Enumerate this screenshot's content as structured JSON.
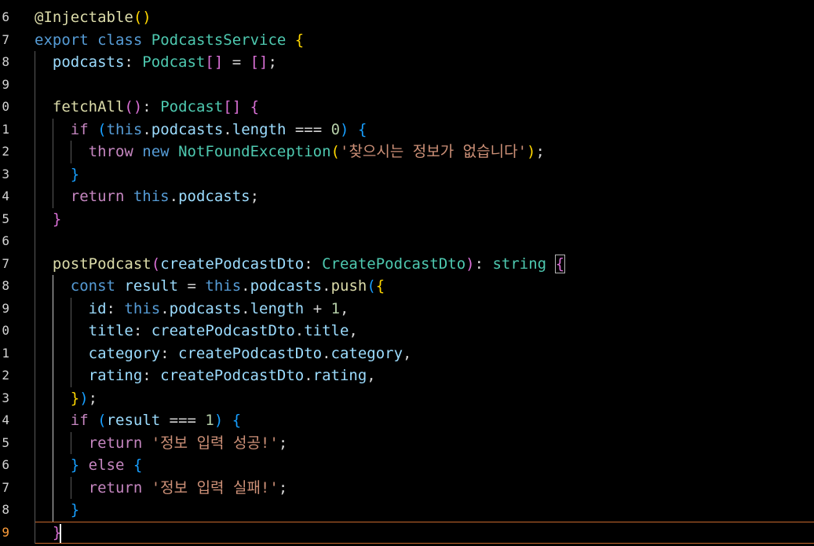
{
  "editor": {
    "gutter_digits": [
      "6",
      "7",
      "8",
      "9",
      "0",
      "1",
      "2",
      "3",
      "4",
      "5",
      "6",
      "7",
      "8",
      "9",
      "0",
      "1",
      "2",
      "3",
      "4",
      "5",
      "6",
      "7",
      "8",
      "9"
    ],
    "active_gutter_index": 23,
    "lines": [
      [
        [
          "@Injectable",
          "fn"
        ],
        [
          "()",
          "br1"
        ]
      ],
      [
        [
          "export",
          "kw-blue"
        ],
        [
          " ",
          "punct"
        ],
        [
          "class",
          "kw-blue"
        ],
        [
          " ",
          "punct"
        ],
        [
          "PodcastsService",
          "type"
        ],
        [
          " ",
          "punct"
        ],
        [
          "{",
          "br1"
        ]
      ],
      [
        [
          "  ",
          "punct"
        ],
        [
          "podcasts",
          "var"
        ],
        [
          ": ",
          "punct"
        ],
        [
          "Podcast",
          "type"
        ],
        [
          "[]",
          "br2"
        ],
        [
          " = ",
          "punct"
        ],
        [
          "[]",
          "br2"
        ],
        [
          ";",
          "punct"
        ]
      ],
      [
        [
          "",
          "punct"
        ]
      ],
      [
        [
          "  ",
          "punct"
        ],
        [
          "fetchAll",
          "fn"
        ],
        [
          "()",
          "br2"
        ],
        [
          ": ",
          "punct"
        ],
        [
          "Podcast",
          "type"
        ],
        [
          "[]",
          "br2"
        ],
        [
          " ",
          "punct"
        ],
        [
          "{",
          "br2"
        ]
      ],
      [
        [
          "    ",
          "punct"
        ],
        [
          "if",
          "kw-pink"
        ],
        [
          " ",
          "punct"
        ],
        [
          "(",
          "br3"
        ],
        [
          "this",
          "kw-blue"
        ],
        [
          ".",
          "punct"
        ],
        [
          "podcasts",
          "var"
        ],
        [
          ".",
          "punct"
        ],
        [
          "length",
          "var"
        ],
        [
          " === ",
          "punct"
        ],
        [
          "0",
          "num"
        ],
        [
          ")",
          "br3"
        ],
        [
          " ",
          "punct"
        ],
        [
          "{",
          "br3"
        ]
      ],
      [
        [
          "      ",
          "punct"
        ],
        [
          "throw",
          "kw-pink"
        ],
        [
          " ",
          "punct"
        ],
        [
          "new",
          "kw-blue"
        ],
        [
          " ",
          "punct"
        ],
        [
          "NotFoundException",
          "type"
        ],
        [
          "(",
          "br1"
        ],
        [
          "'찾으시는 정보가 없습니다'",
          "str"
        ],
        [
          ")",
          "br1"
        ],
        [
          ";",
          "punct"
        ]
      ],
      [
        [
          "    ",
          "punct"
        ],
        [
          "}",
          "br3"
        ]
      ],
      [
        [
          "    ",
          "punct"
        ],
        [
          "return",
          "kw-pink"
        ],
        [
          " ",
          "punct"
        ],
        [
          "this",
          "kw-blue"
        ],
        [
          ".",
          "punct"
        ],
        [
          "podcasts",
          "var"
        ],
        [
          ";",
          "punct"
        ]
      ],
      [
        [
          "  ",
          "punct"
        ],
        [
          "}",
          "br2"
        ]
      ],
      [
        [
          "",
          "punct"
        ]
      ],
      [
        [
          "  ",
          "punct"
        ],
        [
          "postPodcast",
          "fn"
        ],
        [
          "(",
          "br2"
        ],
        [
          "createPodcastDto",
          "var"
        ],
        [
          ": ",
          "punct"
        ],
        [
          "CreatePodcastDto",
          "type"
        ],
        [
          ")",
          "br2"
        ],
        [
          ": ",
          "punct"
        ],
        [
          "string",
          "type"
        ],
        [
          " ",
          "punct"
        ],
        [
          "{",
          "br2"
        ]
      ],
      [
        [
          "    ",
          "punct"
        ],
        [
          "const",
          "kw-blue"
        ],
        [
          " ",
          "punct"
        ],
        [
          "result",
          "var"
        ],
        [
          " = ",
          "punct"
        ],
        [
          "this",
          "kw-blue"
        ],
        [
          ".",
          "punct"
        ],
        [
          "podcasts",
          "var"
        ],
        [
          ".",
          "punct"
        ],
        [
          "push",
          "fn"
        ],
        [
          "(",
          "br3"
        ],
        [
          "{",
          "br1"
        ]
      ],
      [
        [
          "      ",
          "punct"
        ],
        [
          "id",
          "var"
        ],
        [
          ": ",
          "punct"
        ],
        [
          "this",
          "kw-blue"
        ],
        [
          ".",
          "punct"
        ],
        [
          "podcasts",
          "var"
        ],
        [
          ".",
          "punct"
        ],
        [
          "length",
          "var"
        ],
        [
          " + ",
          "punct"
        ],
        [
          "1",
          "num"
        ],
        [
          ",",
          "punct"
        ]
      ],
      [
        [
          "      ",
          "punct"
        ],
        [
          "title",
          "var"
        ],
        [
          ": ",
          "punct"
        ],
        [
          "createPodcastDto",
          "var"
        ],
        [
          ".",
          "punct"
        ],
        [
          "title",
          "var"
        ],
        [
          ",",
          "punct"
        ]
      ],
      [
        [
          "      ",
          "punct"
        ],
        [
          "category",
          "var"
        ],
        [
          ": ",
          "punct"
        ],
        [
          "createPodcastDto",
          "var"
        ],
        [
          ".",
          "punct"
        ],
        [
          "category",
          "var"
        ],
        [
          ",",
          "punct"
        ]
      ],
      [
        [
          "      ",
          "punct"
        ],
        [
          "rating",
          "var"
        ],
        [
          ": ",
          "punct"
        ],
        [
          "createPodcastDto",
          "var"
        ],
        [
          ".",
          "punct"
        ],
        [
          "rating",
          "var"
        ],
        [
          ",",
          "punct"
        ]
      ],
      [
        [
          "    ",
          "punct"
        ],
        [
          "}",
          "br1"
        ],
        [
          ")",
          "br3"
        ],
        [
          ";",
          "punct"
        ]
      ],
      [
        [
          "    ",
          "punct"
        ],
        [
          "if",
          "kw-pink"
        ],
        [
          " ",
          "punct"
        ],
        [
          "(",
          "br3"
        ],
        [
          "result",
          "var"
        ],
        [
          " === ",
          "punct"
        ],
        [
          "1",
          "num"
        ],
        [
          ")",
          "br3"
        ],
        [
          " ",
          "punct"
        ],
        [
          "{",
          "br3"
        ]
      ],
      [
        [
          "      ",
          "punct"
        ],
        [
          "return",
          "kw-pink"
        ],
        [
          " ",
          "punct"
        ],
        [
          "'정보 입력 성공!'",
          "str"
        ],
        [
          ";",
          "punct"
        ]
      ],
      [
        [
          "    ",
          "punct"
        ],
        [
          "}",
          "br3"
        ],
        [
          " ",
          "punct"
        ],
        [
          "else",
          "kw-pink"
        ],
        [
          " ",
          "punct"
        ],
        [
          "{",
          "br3"
        ]
      ],
      [
        [
          "      ",
          "punct"
        ],
        [
          "return",
          "kw-pink"
        ],
        [
          " ",
          "punct"
        ],
        [
          "'정보 입력 실패!'",
          "str"
        ],
        [
          ";",
          "punct"
        ]
      ],
      [
        [
          "    ",
          "punct"
        ],
        [
          "}",
          "br3"
        ]
      ],
      [
        [
          "  ",
          "punct"
        ],
        [
          "}",
          "br2"
        ]
      ]
    ]
  },
  "colors": {
    "background": "#000000",
    "keyword_blue": "#569cd6",
    "keyword_pink": "#c586c0",
    "function": "#dcdcaa",
    "variable": "#9cdcfe",
    "type": "#4ec9b0",
    "string": "#ce9178",
    "number": "#b5cea8",
    "current_line_border": "#c8692e"
  }
}
